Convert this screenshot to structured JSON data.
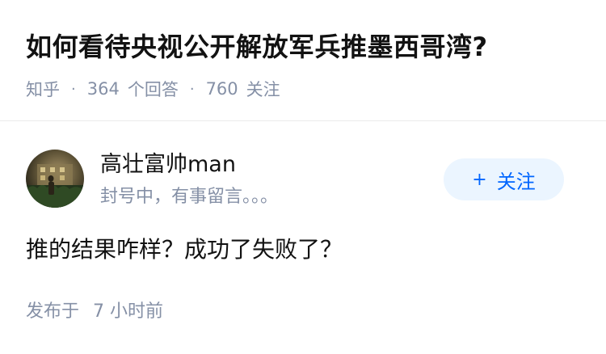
{
  "question": {
    "title": "如何看待央视公开解放军兵推墨西哥湾?",
    "source": "知乎",
    "separator": "·",
    "answer_count": "364",
    "answer_label": "个回答",
    "follower_count": "760",
    "follower_label": "关注"
  },
  "author": {
    "name": "高壮富帅man",
    "bio": "封号中，有事留言。。。",
    "avatar_icon": "avatar-photo"
  },
  "follow_button": {
    "icon": "+",
    "label": "关注"
  },
  "answer": {
    "content": "推的结果咋样？成功了失败了？",
    "published_label": "发布于",
    "published_time": "7 小时前"
  },
  "colors": {
    "accent": "#0066ff",
    "accent_bg": "#ebf5ff",
    "meta_text": "#8590a6",
    "title_text": "#121212"
  }
}
